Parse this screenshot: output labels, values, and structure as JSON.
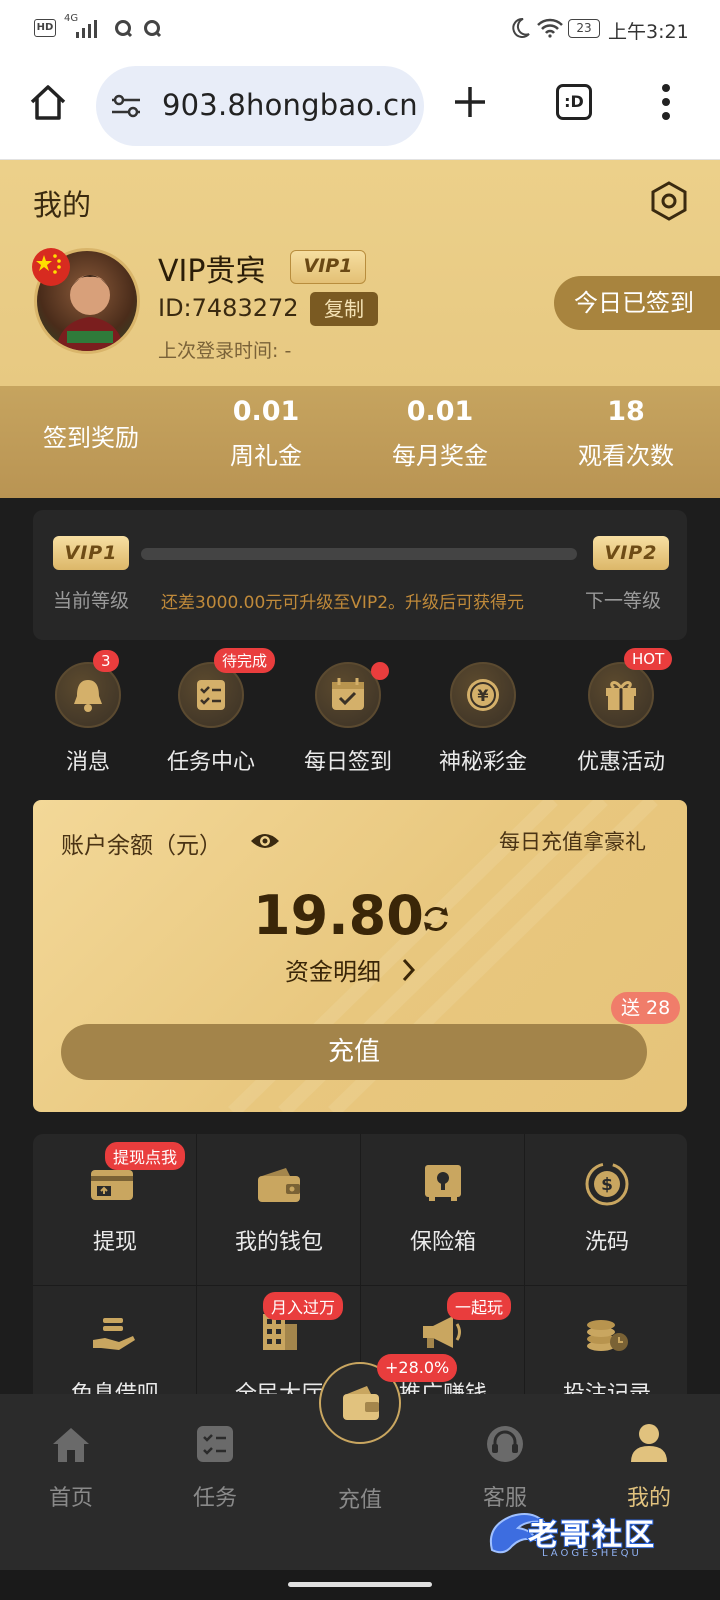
{
  "status_bar": {
    "network": "4G",
    "time": "上午3:21",
    "battery": "23"
  },
  "browser": {
    "url": "903.8hongbao.cn",
    "tab_icon": ":D"
  },
  "header": {
    "title": "我的",
    "nickname": "VIP贵宾",
    "vip_badge": "VIP1",
    "user_id": "ID:7483272",
    "copy_label": "复制",
    "last_login": "上次登录时间: -",
    "checkin_button": "今日已签到"
  },
  "stats": {
    "reward_label": "签到奖励",
    "items": [
      {
        "value": "0.01",
        "label": "周礼金"
      },
      {
        "value": "0.01",
        "label": "每月奖金"
      },
      {
        "value": "18",
        "label": "观看次数"
      }
    ]
  },
  "vip_progress": {
    "current_badge": "VIP1",
    "next_badge": "VIP2",
    "current_label": "当前等级",
    "message": "还差3000.00元可升级至VIP2。升级后可获得元",
    "next_label": "下一等级",
    "progress": 0.0
  },
  "quick_icons": [
    {
      "label": "消息",
      "badge": "3",
      "icon": "bell-icon"
    },
    {
      "label": "任务中心",
      "badge": "待完成",
      "icon": "task-icon"
    },
    {
      "label": "每日签到",
      "badge": "",
      "icon": "calendar-icon"
    },
    {
      "label": "神秘彩金",
      "badge": "",
      "icon": "yen-coin-icon"
    },
    {
      "label": "优惠活动",
      "badge": "HOT",
      "icon": "gift-icon"
    }
  ],
  "balance": {
    "title": "账户余额（元）",
    "promo": "每日充值拿豪礼",
    "amount": "19.80",
    "details": "资金明细",
    "recharge": "充值",
    "bonus": "送 28"
  },
  "grid": [
    {
      "label": "提现",
      "badge": "提现点我",
      "icon": "withdraw-card-icon"
    },
    {
      "label": "我的钱包",
      "badge": "",
      "icon": "wallet-icon"
    },
    {
      "label": "保险箱",
      "badge": "",
      "icon": "safe-icon"
    },
    {
      "label": "洗码",
      "badge": "",
      "icon": "rebate-coin-icon"
    },
    {
      "label": "免息借呗",
      "badge": "",
      "icon": "loan-hand-icon"
    },
    {
      "label": "全民大厅",
      "badge": "月入过万",
      "icon": "building-icon"
    },
    {
      "label": "推广赚钱",
      "badge": "一起玩",
      "icon": "megaphone-icon"
    },
    {
      "label": "投注记录",
      "badge": "",
      "icon": "coins-record-icon"
    }
  ],
  "tabbar": [
    {
      "label": "首页",
      "icon": "home-icon"
    },
    {
      "label": "任务",
      "icon": "task-list-icon"
    },
    {
      "label": "充值",
      "icon": "wallet-center-icon",
      "badge": "+28.0%"
    },
    {
      "label": "客服",
      "icon": "headset-icon"
    },
    {
      "label": "我的",
      "icon": "user-icon"
    }
  ],
  "watermark": {
    "text": "老哥社区",
    "sub": "LAOGESHEQU"
  },
  "colors": {
    "gold": "#e9cb84",
    "dark": "#1d1d1d",
    "accent_red": "#e93d3d",
    "text_brown": "#4a3314"
  }
}
